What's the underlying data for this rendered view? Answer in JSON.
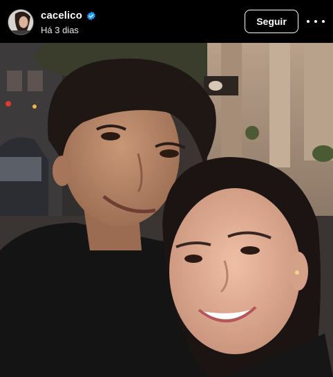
{
  "post": {
    "username": "cacelico",
    "verified": true,
    "timestamp": "Há 3 dias",
    "follow_label": "Seguir",
    "more_icon": "more-horizontal-icon"
  },
  "photo": {
    "subject": "selfie"
  },
  "colors": {
    "header_bg": "#000000",
    "verified_blue": "#1d9bf0",
    "text": "#ffffff"
  }
}
